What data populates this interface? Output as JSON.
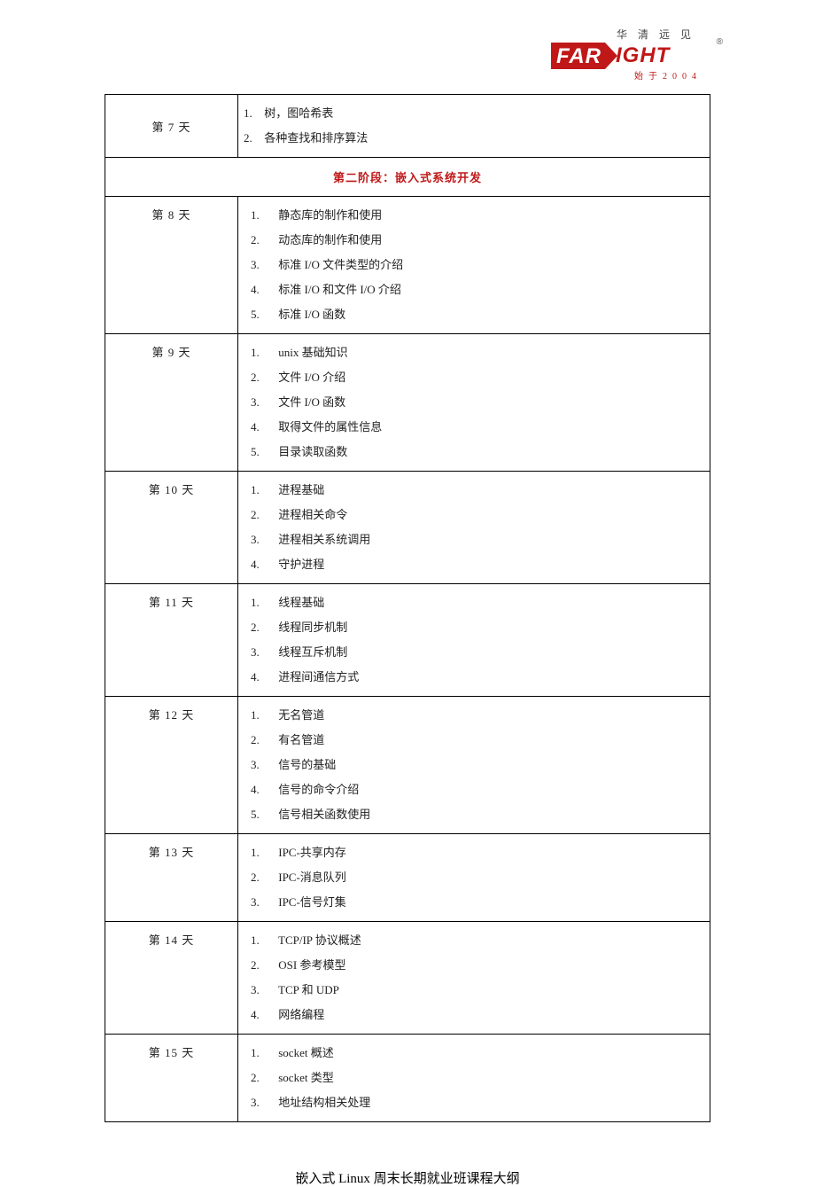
{
  "logo": {
    "top": "华清远见",
    "brand_left": "FAR",
    "brand_right": "IGHT",
    "reg": "®",
    "bottom": "始于2004"
  },
  "stage": "第二阶段：嵌入式系统开发",
  "footer": {
    "pre": "嵌入式 ",
    "latin": "Linux",
    "post": " 周末长期就业班课程大纲"
  },
  "rows": [
    {
      "day": "第 7 天",
      "items": [
        "树，图哈希表",
        "各种查找和排序算法"
      ]
    },
    {
      "day": "第 8 天",
      "items": [
        "静态库的制作和使用",
        "动态库的制作和使用",
        "标准 I/O 文件类型的介绍",
        "标准 I/O 和文件 I/O 介绍",
        "标准 I/O 函数"
      ]
    },
    {
      "day": "第 9 天",
      "items": [
        "unix 基础知识",
        "文件 I/O 介绍",
        "文件 I/O 函数",
        "取得文件的属性信息",
        "目录读取函数"
      ]
    },
    {
      "day": "第 10 天",
      "items": [
        "进程基础",
        "进程相关命令",
        "进程相关系统调用",
        "守护进程"
      ]
    },
    {
      "day": "第 11 天",
      "items": [
        "线程基础",
        "线程同步机制",
        "线程互斥机制",
        "进程间通信方式"
      ]
    },
    {
      "day": "第 12 天",
      "items": [
        "无名管道",
        "有名管道",
        "信号的基础",
        "信号的命令介绍",
        "信号相关函数使用"
      ]
    },
    {
      "day": "第 13 天",
      "items": [
        "IPC-共享内存",
        "IPC-消息队列",
        "IPC-信号灯集"
      ]
    },
    {
      "day": "第 14 天",
      "items": [
        "TCP/IP 协议概述",
        "OSI 参考模型",
        "TCP 和 UDP",
        "网络编程"
      ]
    },
    {
      "day": "第 15 天",
      "items": [
        "socket 概述",
        "socket 类型",
        "地址结构相关处理"
      ]
    }
  ]
}
